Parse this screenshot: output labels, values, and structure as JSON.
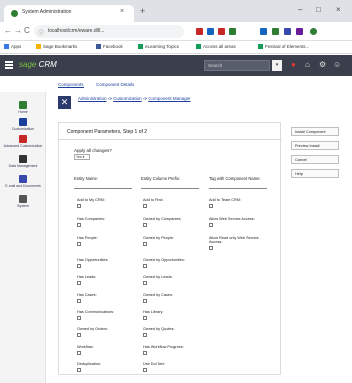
{
  "browser": {
    "tab_title": "System Administration",
    "tab_close": "×",
    "new_tab": "+",
    "minimize": "–",
    "maximize": "□",
    "close": "×",
    "back": "←",
    "forward": "→",
    "reload": "C",
    "info": "ⓘ",
    "url": "localhost/crm/eware.dll/...",
    "bookmarks": [
      {
        "label": "Apps",
        "color": "#3b78e7"
      },
      {
        "label": "Sage Bookmarks",
        "color": "#f4b400"
      },
      {
        "label": "Facebook",
        "color": "#3b5998"
      },
      {
        "label": "eLearning Topics",
        "color": "#0f9d58"
      },
      {
        "label": "Access all areas",
        "color": "#0f9d58"
      },
      {
        "label": "Festival of Elements...",
        "color": "#0f9d58"
      }
    ]
  },
  "crm": {
    "logo_brand": "sage",
    "logo_product": " CRM",
    "search_placeholder": "Search",
    "search_button": "▾"
  },
  "subtabs": [
    "Components",
    "Component Details"
  ],
  "leftnav": [
    {
      "label": "Home",
      "color": "#2e7d32"
    },
    {
      "label": "Customization",
      "color": "#1a3f9c"
    },
    {
      "label": "Advanced Customization",
      "color": "#c62828"
    },
    {
      "label": "Data Management",
      "color": "#333333"
    },
    {
      "label": "E-mail and Documents",
      "color": "#3949ab"
    },
    {
      "label": "System",
      "color": "#555555"
    }
  ],
  "breadcrumb": {
    "items": [
      "Administration",
      "Customization",
      "Component Manager"
    ],
    "sep": " -> "
  },
  "panel": {
    "title": "Component Parameters, Step 1 of 2",
    "apply_label": "Apply all changes?",
    "apply_value": "Yes ▾",
    "fields": [
      {
        "label": "Entity Name:"
      },
      {
        "label": "Entity Column Prefix:"
      },
      {
        "label": "Tag with Component Name:"
      }
    ],
    "checkboxes": [
      [
        "Add to My CRM:",
        "Add to Find:",
        "Add to Team CRM:"
      ],
      [
        "Has Companies:",
        "Owned by Companies:",
        "Allow Web Service Access:"
      ],
      [
        "Has People:",
        "Owned by People:",
        "Allow Read only Web Service Access:"
      ],
      [
        "Has Opportunities:",
        "Owned by Opportunities:",
        ""
      ],
      [
        "Has Leads:",
        "Owned by Leads:",
        ""
      ],
      [
        "Has Cases:",
        "Owned by Cases:",
        ""
      ],
      [
        "Has Communications:",
        "Has Library:",
        ""
      ],
      [
        "Owned by Orders:",
        "Owned by Quotes:",
        ""
      ],
      [
        "Workflow:",
        "Has Workflow Progress:",
        ""
      ],
      [
        "Deduplication:",
        "Use Dot Net:",
        ""
      ]
    ]
  },
  "actions": [
    "Install Component",
    "Preview Install",
    "Cancel",
    "Help"
  ]
}
